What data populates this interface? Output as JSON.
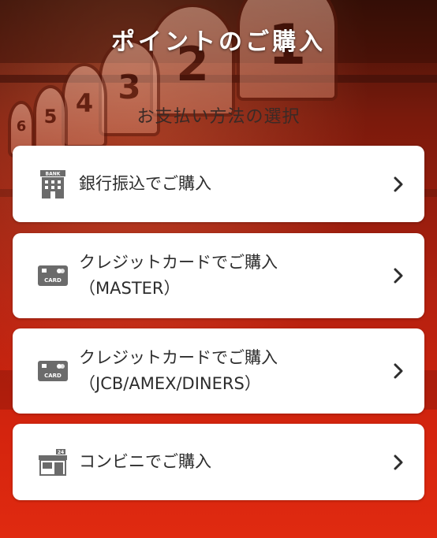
{
  "header": {
    "title": "ポイントのご購入",
    "subtitle": "お支払い方法の選択"
  },
  "payment_methods": [
    {
      "icon": "bank-building-icon",
      "icon_text": "BANK",
      "lines": [
        "銀行振込でご購入"
      ]
    },
    {
      "icon": "credit-card-icon",
      "icon_text": "CARD",
      "lines": [
        "クレジットカードでご購入",
        "（MASTER）"
      ]
    },
    {
      "icon": "credit-card-icon",
      "icon_text": "CARD",
      "lines": [
        "クレジットカードでご購入",
        "（JCB/AMEX/DINERS）"
      ]
    },
    {
      "icon": "convenience-store-icon",
      "icon_text": "24",
      "lines": [
        "コンビニでご購入"
      ]
    }
  ],
  "background": {
    "board_numbers": [
      "1",
      "2",
      "3",
      "4",
      "5",
      "6"
    ]
  },
  "colors": {
    "card_bg": "#ffffff",
    "text": "#2d2d2d",
    "icon_gray": "#6b6b6b",
    "bg_red": "#d4240e"
  }
}
